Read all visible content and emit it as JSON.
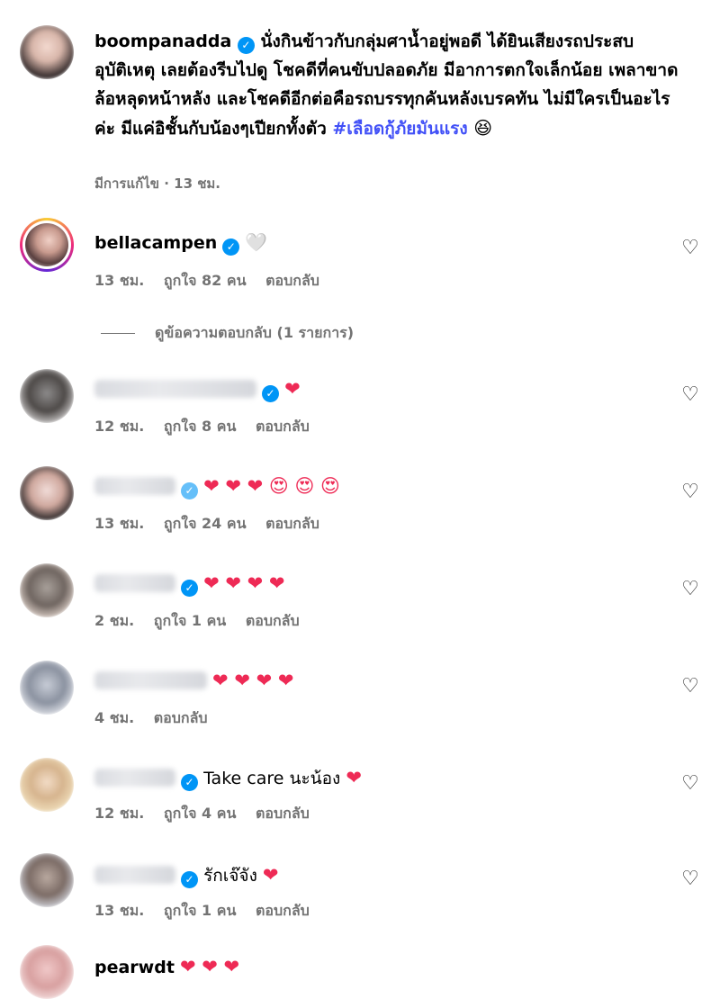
{
  "caption": {
    "username": "boompanadda",
    "text": "นั่งกินข้าวกับกลุ่มศาน้ำอยู่พอดี ได้ยินเสียงรถประสบอุบัติเหตุ เลยต้องรีบไปดู โชคดีที่คนขับปลอดภัย มีอาการตกใจเล็กน้อย เพลาขาด ล้อหลุดหน้าหลัง และโชคดีอีกต่อคือรถบรรทุกคันหลังเบรคทัน ไม่มีใครเป็นอะไรค่ะ มีแค่อิชั้นกับน้องๆเปียกทั้งตัว",
    "hashtag": "#เลือดกู้ภัยมันแรง",
    "emoji": "😆",
    "meta": "มีการแก้ไข · 13 ชม."
  },
  "icons": {
    "verified": "verified-badge-icon",
    "like": "heart-outline-icon"
  },
  "comments": [
    {
      "username": "bellacampen",
      "text": "🤍",
      "time": "13 ชม.",
      "likes": "ถูกใจ 82 คน",
      "reply": "ตอบกลับ"
    },
    {
      "text": "❤",
      "time": "12 ชม.",
      "likes": "ถูกใจ 8 คน",
      "reply": "ตอบกลับ"
    },
    {
      "text": "❤ ❤ ❤ 😍 😍 😍",
      "time": "13 ชม.",
      "likes": "ถูกใจ 24 คน",
      "reply": "ตอบกลับ"
    },
    {
      "text": "❤ ❤ ❤ ❤",
      "time": "2 ชม.",
      "likes": "ถูกใจ 1 คน",
      "reply": "ตอบกลับ"
    },
    {
      "text": "❤ ❤ ❤ ❤",
      "time": "4 ชม.",
      "reply": "ตอบกลับ"
    },
    {
      "text": "Take care นะน้อง",
      "emoji": "❤",
      "time": "12 ชม.",
      "likes": "ถูกใจ 4 คน",
      "reply": "ตอบกลับ"
    },
    {
      "text": "รักเจ๊จัง",
      "emoji": "❤",
      "time": "13 ชม.",
      "likes": "ถูกใจ 1 คน",
      "reply": "ตอบกลับ"
    },
    {
      "username": "pearwdt",
      "text": "❤ ❤ ❤"
    }
  ],
  "view_replies": "ดูข้อความตอบกลับ (1 รายการ)",
  "colors": {
    "hashtag": "#4150f7",
    "meta": "#737373",
    "verified": "#0095f6",
    "heart": "#ee2a55"
  }
}
